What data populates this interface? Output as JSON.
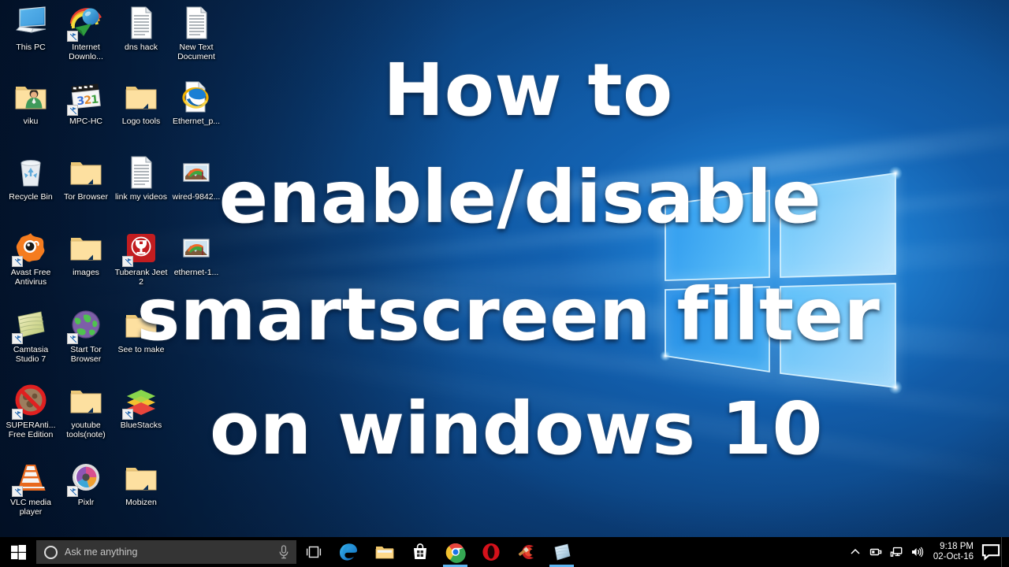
{
  "title_overlay": {
    "lines": [
      "How to",
      "enable/disable",
      "smartscreen filter",
      "on windows 10"
    ],
    "color": "#ffffff"
  },
  "desktop": {
    "wallpaper_name": "windows-10-hero",
    "icons": [
      {
        "label": "This PC",
        "icon": "this-pc-icon",
        "shortcut": false,
        "col": 0,
        "row": 0
      },
      {
        "label": "Internet Downlo...",
        "icon": "internet-download-manager-icon",
        "shortcut": true,
        "col": 1,
        "row": 0
      },
      {
        "label": "dns hack",
        "icon": "text-document-icon",
        "shortcut": false,
        "col": 2,
        "row": 0
      },
      {
        "label": "New Text Document",
        "icon": "text-document-icon",
        "shortcut": false,
        "col": 3,
        "row": 0
      },
      {
        "label": "viku",
        "icon": "user-folder-icon",
        "shortcut": false,
        "col": 0,
        "row": 1
      },
      {
        "label": "MPC-HC",
        "icon": "mpc-hc-icon",
        "shortcut": true,
        "col": 1,
        "row": 1
      },
      {
        "label": "Logo tools",
        "icon": "folder-icon",
        "shortcut": false,
        "col": 2,
        "row": 1
      },
      {
        "label": "Ethernet_p...",
        "icon": "internet-explorer-file-icon",
        "shortcut": false,
        "col": 3,
        "row": 1
      },
      {
        "label": "Recycle Bin",
        "icon": "recycle-bin-icon",
        "shortcut": false,
        "col": 0,
        "row": 2
      },
      {
        "label": "Tor Browser",
        "icon": "folder-icon",
        "shortcut": false,
        "col": 1,
        "row": 2
      },
      {
        "label": "link my videos",
        "icon": "text-document-icon",
        "shortcut": false,
        "col": 2,
        "row": 2
      },
      {
        "label": "wired-9842...",
        "icon": "image-file-icon",
        "shortcut": false,
        "col": 3,
        "row": 2
      },
      {
        "label": "Avast Free Antivirus",
        "icon": "avast-icon",
        "shortcut": true,
        "col": 0,
        "row": 3
      },
      {
        "label": "images",
        "icon": "folder-icon",
        "shortcut": false,
        "col": 1,
        "row": 3
      },
      {
        "label": "Tuberank Jeet 2",
        "icon": "tuberank-jeet-icon",
        "shortcut": true,
        "col": 2,
        "row": 3
      },
      {
        "label": "ethernet-1...",
        "icon": "image-file-icon",
        "shortcut": false,
        "col": 3,
        "row": 3
      },
      {
        "label": "Camtasia Studio 7",
        "icon": "camtasia-icon",
        "shortcut": true,
        "col": 0,
        "row": 4
      },
      {
        "label": "Start Tor Browser",
        "icon": "tor-browser-icon",
        "shortcut": true,
        "col": 1,
        "row": 4
      },
      {
        "label": "See to make",
        "icon": "folder-icon",
        "shortcut": false,
        "col": 2,
        "row": 4
      },
      {
        "label": "SUPERAnti... Free Edition",
        "icon": "superantispyware-icon",
        "shortcut": true,
        "col": 0,
        "row": 5
      },
      {
        "label": "youtube tools(note)",
        "icon": "folder-icon",
        "shortcut": false,
        "col": 1,
        "row": 5
      },
      {
        "label": "BlueStacks",
        "icon": "bluestacks-icon",
        "shortcut": true,
        "col": 2,
        "row": 5
      },
      {
        "label": "VLC media player",
        "icon": "vlc-icon",
        "shortcut": true,
        "col": 0,
        "row": 6
      },
      {
        "label": "Pixlr",
        "icon": "pixlr-icon",
        "shortcut": true,
        "col": 1,
        "row": 6
      },
      {
        "label": "Mobizen",
        "icon": "folder-icon",
        "shortcut": false,
        "col": 2,
        "row": 6
      }
    ]
  },
  "taskbar": {
    "start_label": "Start",
    "start_icon": "windows-logo-icon",
    "search": {
      "placeholder": "Ask me anything",
      "value": "",
      "cortana_icon": "cortana-ring-icon",
      "mic_icon": "microphone-icon"
    },
    "task_view_icon": "task-view-icon",
    "apps": [
      {
        "name": "Microsoft Edge",
        "icon": "edge-icon",
        "active": false
      },
      {
        "name": "File Explorer",
        "icon": "file-explorer-icon",
        "active": false
      },
      {
        "name": "Microsoft Store",
        "icon": "store-icon",
        "active": false
      },
      {
        "name": "Google Chrome",
        "icon": "chrome-icon",
        "active": true
      },
      {
        "name": "Opera",
        "icon": "opera-icon",
        "active": false
      },
      {
        "name": "CCleaner",
        "icon": "ccleaner-icon",
        "active": false
      },
      {
        "name": "Camtasia Studio",
        "icon": "camtasia-icon",
        "active": true
      }
    ],
    "tray": {
      "overflow_icon": "chevron-up-icon",
      "icons": [
        {
          "name": "removable-media-icon"
        },
        {
          "name": "network-icon"
        },
        {
          "name": "volume-icon"
        }
      ],
      "time": "9:18 PM",
      "date": "02-Oct-16",
      "notifications_icon": "notification-bell-icon"
    }
  }
}
